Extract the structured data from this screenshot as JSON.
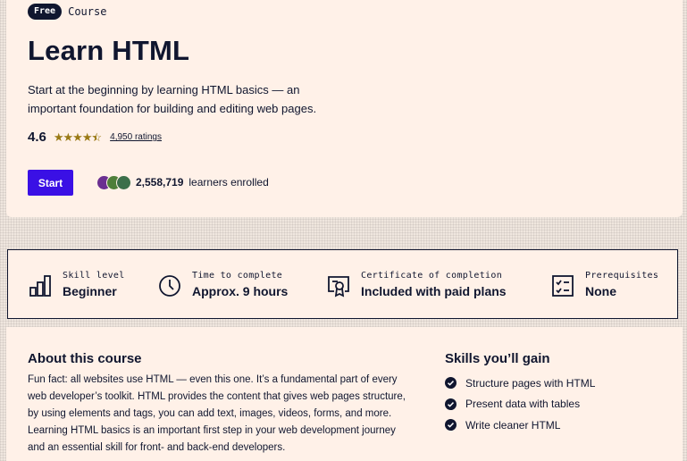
{
  "hero": {
    "badge": "Free",
    "course_label": "Course",
    "title": "Learn HTML",
    "description": "Start at the beginning by learning HTML basics — an important foundation for building and editing web pages.",
    "rating": "4.6",
    "stars": 4.5,
    "ratings_link": "4,950 ratings",
    "start_button": "Start",
    "learners_count": "2,558,719",
    "learners_text": "learners enrolled"
  },
  "info": [
    {
      "label": "Skill level",
      "value": "Beginner",
      "icon": "bar-chart-icon"
    },
    {
      "label": "Time to complete",
      "value": "Approx. 9 hours",
      "icon": "clock-icon"
    },
    {
      "label": "Certificate of completion",
      "value": "Included with paid plans",
      "icon": "certificate-icon"
    },
    {
      "label": "Prerequisites",
      "value": "None",
      "icon": "checklist-icon"
    }
  ],
  "about": {
    "title": "About this course",
    "text": "Fun fact: all websites use HTML — even this one. It’s a fundamental part of every web developer’s toolkit. HTML provides the content that gives web pages structure, by using elements and tags, you can add text, images, videos, forms, and more. Learning HTML basics is an important first step in your web development journey and an essential skill for front- and back-end developers."
  },
  "skills": {
    "title": "Skills you’ll gain",
    "items": [
      "Structure pages with HTML",
      "Present data with tables",
      "Write cleaner HTML"
    ]
  },
  "colors": {
    "accent": "#3a10e5",
    "ink": "#10162f",
    "background": "#fff1e8",
    "star": "#9a7a16"
  }
}
